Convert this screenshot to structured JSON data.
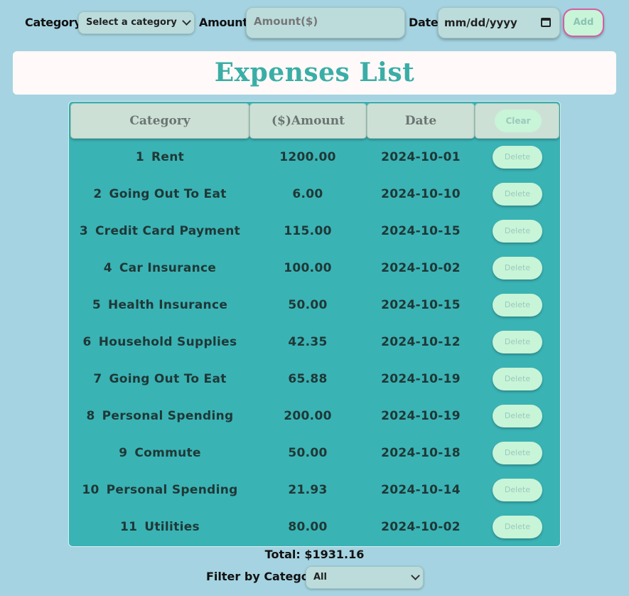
{
  "form": {
    "category_label": "Category:",
    "category_placeholder": "Select a category",
    "amount_label": "Amount:",
    "amount_placeholder": "Amount($)",
    "date_label": "Date:",
    "date_placeholder": "mm/dd/yyyy",
    "add_label": "Add"
  },
  "title": "Expenses List",
  "table": {
    "headers": {
      "category": "Category",
      "amount": "($)Amount",
      "date": "Date",
      "clear_label": "Clear"
    },
    "delete_label": "Delete",
    "rows": [
      {
        "index": "1",
        "category": "Rent",
        "amount": "1200.00",
        "date": "2024-10-01"
      },
      {
        "index": "2",
        "category": "Going Out To Eat",
        "amount": "6.00",
        "date": "2024-10-10"
      },
      {
        "index": "3",
        "category": "Credit Card Payment",
        "amount": "115.00",
        "date": "2024-10-15"
      },
      {
        "index": "4",
        "category": "Car Insurance",
        "amount": "100.00",
        "date": "2024-10-02"
      },
      {
        "index": "5",
        "category": "Health Insurance",
        "amount": "50.00",
        "date": "2024-10-15"
      },
      {
        "index": "6",
        "category": "Household Supplies",
        "amount": "42.35",
        "date": "2024-10-12"
      },
      {
        "index": "7",
        "category": "Going Out To Eat",
        "amount": "65.88",
        "date": "2024-10-19"
      },
      {
        "index": "8",
        "category": "Personal Spending",
        "amount": "200.00",
        "date": "2024-10-19"
      },
      {
        "index": "9",
        "category": "Commute",
        "amount": "50.00",
        "date": "2024-10-18"
      },
      {
        "index": "10",
        "category": "Personal Spending",
        "amount": "21.93",
        "date": "2024-10-14"
      },
      {
        "index": "11",
        "category": "Utilities",
        "amount": "80.00",
        "date": "2024-10-02"
      }
    ]
  },
  "total_text": "Total: $1931.16",
  "filter": {
    "label": "Filter by Category:",
    "selected": "All"
  },
  "colors": {
    "background": "#a5d3e1",
    "title": "#3aaea6",
    "table_bg": "#3ab3b5",
    "button_bg": "#c8f4d8",
    "add_border": "#d85ca6"
  }
}
